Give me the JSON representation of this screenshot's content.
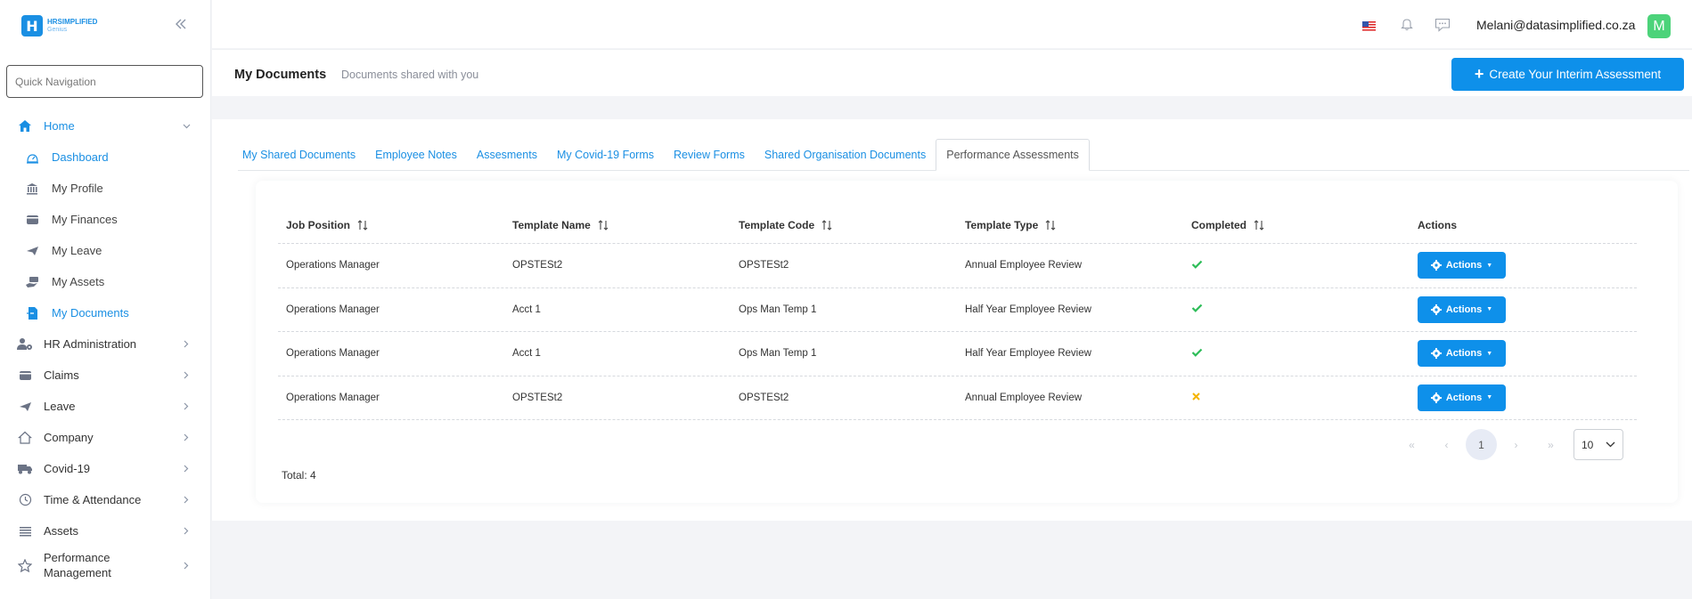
{
  "sidebar": {
    "logo_text": "HRSIMPLIFIED",
    "logo_sub": "Genius",
    "quick_nav_placeholder": "Quick Navigation",
    "items": [
      {
        "label": "Home",
        "icon": "home-icon"
      },
      {
        "label": "Dashboard",
        "icon": "dashboard-icon"
      },
      {
        "label": "My Profile",
        "icon": "bank-icon"
      },
      {
        "label": "My Finances",
        "icon": "wallet-icon"
      },
      {
        "label": "My Leave",
        "icon": "plane-icon"
      },
      {
        "label": "My Assets",
        "icon": "hand-money-icon"
      },
      {
        "label": "My Documents",
        "icon": "document-icon"
      },
      {
        "label": "HR Administration",
        "icon": "user-gear-icon"
      },
      {
        "label": "Claims",
        "icon": "wallet-icon"
      },
      {
        "label": "Leave",
        "icon": "plane-icon"
      },
      {
        "label": "Company",
        "icon": "house-icon"
      },
      {
        "label": "Covid-19",
        "icon": "truck-icon"
      },
      {
        "label": "Time & Attendance",
        "icon": "clock-icon"
      },
      {
        "label": "Assets",
        "icon": "list-icon"
      },
      {
        "label": "Performance Management",
        "icon": "star-icon"
      }
    ]
  },
  "topbar": {
    "email": "Melani@datasimplified.co.za",
    "avatar_letter": "M"
  },
  "header": {
    "title": "My Documents",
    "subtitle": "Documents shared with you",
    "create_button": "Create Your Interim Assessment"
  },
  "tabs": [
    {
      "label": "My Shared Documents"
    },
    {
      "label": "Employee Notes"
    },
    {
      "label": "Assesments"
    },
    {
      "label": "My Covid-19 Forms"
    },
    {
      "label": "Review Forms"
    },
    {
      "label": "Shared Organisation Documents"
    },
    {
      "label": "Performance Assessments"
    }
  ],
  "table": {
    "columns": [
      "Job Position",
      "Template Name",
      "Template Code",
      "Template Type",
      "Completed",
      "Actions"
    ],
    "rows": [
      {
        "job_position": "Operations Manager",
        "template_name": "OPSTESt2",
        "template_code": "OPSTESt2",
        "template_type": "Annual Employee Review",
        "completed": true
      },
      {
        "job_position": "Operations Manager",
        "template_name": "Acct 1",
        "template_code": "Ops Man Temp 1",
        "template_type": "Half Year Employee Review",
        "completed": true
      },
      {
        "job_position": "Operations Manager",
        "template_name": "Acct 1",
        "template_code": "Ops Man Temp 1",
        "template_type": "Half Year Employee Review",
        "completed": true
      },
      {
        "job_position": "Operations Manager",
        "template_name": "OPSTESt2",
        "template_code": "OPSTESt2",
        "template_type": "Annual Employee Review",
        "completed": false
      }
    ],
    "actions_label": "Actions"
  },
  "pagination": {
    "current_page": "1",
    "page_size": "10"
  },
  "total_label": "Total: 4",
  "colors": {
    "primary": "#0e90ea",
    "check": "#2ebd59",
    "cross": "#f5b400",
    "avatar": "#4cd37a"
  }
}
